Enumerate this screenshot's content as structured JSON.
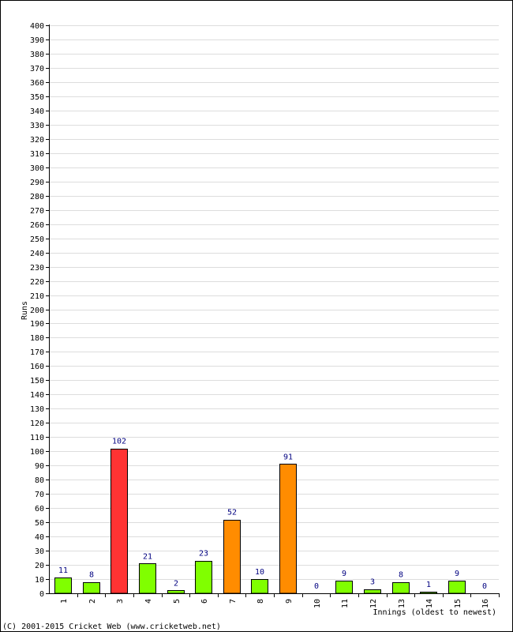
{
  "chart_data": {
    "type": "bar",
    "xlabel": "Innings (oldest to newest)",
    "ylabel": "Runs",
    "ylim": [
      0,
      400
    ],
    "ytick_step": 10,
    "grid": true,
    "categories": [
      "1",
      "2",
      "3",
      "4",
      "5",
      "6",
      "7",
      "8",
      "9",
      "10",
      "11",
      "12",
      "13",
      "14",
      "15",
      "16"
    ],
    "values": [
      11,
      8,
      102,
      21,
      2,
      23,
      52,
      10,
      91,
      0,
      9,
      3,
      8,
      1,
      9,
      0
    ],
    "bar_colors": [
      "#80ff00",
      "#80ff00",
      "#ff3333",
      "#80ff00",
      "#80ff00",
      "#80ff00",
      "#ff8c00",
      "#80ff00",
      "#ff8c00",
      "#80ff00",
      "#80ff00",
      "#80ff00",
      "#80ff00",
      "#80ff00",
      "#80ff00",
      "#80ff00"
    ],
    "label_color": "#000080",
    "grid_color": "#dddddd"
  },
  "footer": {
    "copyright": "(C) 2001-2015 Cricket Web (www.cricketweb.net)"
  }
}
